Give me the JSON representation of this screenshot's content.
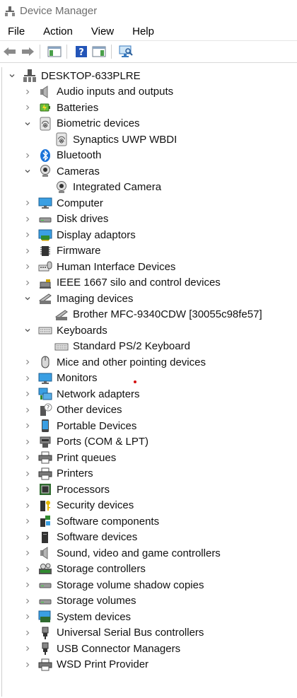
{
  "window": {
    "title": "Device Manager"
  },
  "menu": [
    "File",
    "Action",
    "View",
    "Help"
  ],
  "tree": {
    "root": {
      "label": "DESKTOP-633PLRE",
      "icon": "computer-tower-icon"
    },
    "categories": [
      {
        "label": "Audio inputs and outputs",
        "icon": "speaker-icon",
        "expanded": false
      },
      {
        "label": "Batteries",
        "icon": "battery-icon",
        "expanded": false
      },
      {
        "label": "Biometric devices",
        "icon": "fingerprint-icon",
        "expanded": true,
        "children": [
          {
            "label": "Synaptics UWP WBDI",
            "icon": "fingerprint-icon"
          }
        ]
      },
      {
        "label": "Bluetooth",
        "icon": "bluetooth-icon",
        "expanded": false
      },
      {
        "label": "Cameras",
        "icon": "webcam-icon",
        "expanded": true,
        "children": [
          {
            "label": "Integrated Camera",
            "icon": "webcam-icon"
          }
        ]
      },
      {
        "label": "Computer",
        "icon": "monitor-icon",
        "expanded": false
      },
      {
        "label": "Disk drives",
        "icon": "disk-drive-icon",
        "expanded": false
      },
      {
        "label": "Display adaptors",
        "icon": "display-adapter-icon",
        "expanded": false
      },
      {
        "label": "Firmware",
        "icon": "chip-icon",
        "expanded": false
      },
      {
        "label": "Human Interface Devices",
        "icon": "hid-icon",
        "expanded": false
      },
      {
        "label": "IEEE 1667 silo and control devices",
        "icon": "usb-key-icon",
        "expanded": false
      },
      {
        "label": "Imaging devices",
        "icon": "scanner-icon",
        "expanded": true,
        "children": [
          {
            "label": "Brother MFC-9340CDW [30055c98fe57]",
            "icon": "scanner-icon"
          }
        ]
      },
      {
        "label": "Keyboards",
        "icon": "keyboard-icon",
        "expanded": true,
        "children": [
          {
            "label": "Standard PS/2 Keyboard",
            "icon": "keyboard-icon"
          }
        ]
      },
      {
        "label": "Mice and other pointing devices",
        "icon": "mouse-icon",
        "expanded": false
      },
      {
        "label": "Monitors",
        "icon": "monitor-icon",
        "expanded": false
      },
      {
        "label": "Network adapters",
        "icon": "network-icon",
        "expanded": false
      },
      {
        "label": "Other devices",
        "icon": "unknown-device-icon",
        "expanded": false
      },
      {
        "label": "Portable Devices",
        "icon": "portable-device-icon",
        "expanded": false
      },
      {
        "label": "Ports (COM & LPT)",
        "icon": "port-icon",
        "expanded": false
      },
      {
        "label": "Print queues",
        "icon": "printer-icon",
        "expanded": false
      },
      {
        "label": "Printers",
        "icon": "printer-icon",
        "expanded": false
      },
      {
        "label": "Processors",
        "icon": "processor-icon",
        "expanded": false
      },
      {
        "label": "Security devices",
        "icon": "security-key-icon",
        "expanded": false
      },
      {
        "label": "Software components",
        "icon": "software-component-icon",
        "expanded": false
      },
      {
        "label": "Software devices",
        "icon": "software-device-icon",
        "expanded": false
      },
      {
        "label": "Sound, video and game controllers",
        "icon": "speaker-icon",
        "expanded": false
      },
      {
        "label": "Storage controllers",
        "icon": "storage-controller-icon",
        "expanded": false
      },
      {
        "label": "Storage volume shadow copies",
        "icon": "disk-drive-icon",
        "expanded": false
      },
      {
        "label": "Storage volumes",
        "icon": "disk-drive-icon",
        "expanded": false
      },
      {
        "label": "System devices",
        "icon": "system-device-icon",
        "expanded": false
      },
      {
        "label": "Universal Serial Bus controllers",
        "icon": "usb-icon",
        "expanded": false
      },
      {
        "label": "USB Connector Managers",
        "icon": "usb-icon",
        "expanded": false
      },
      {
        "label": "WSD Print Provider",
        "icon": "printer-icon",
        "expanded": false
      }
    ]
  }
}
